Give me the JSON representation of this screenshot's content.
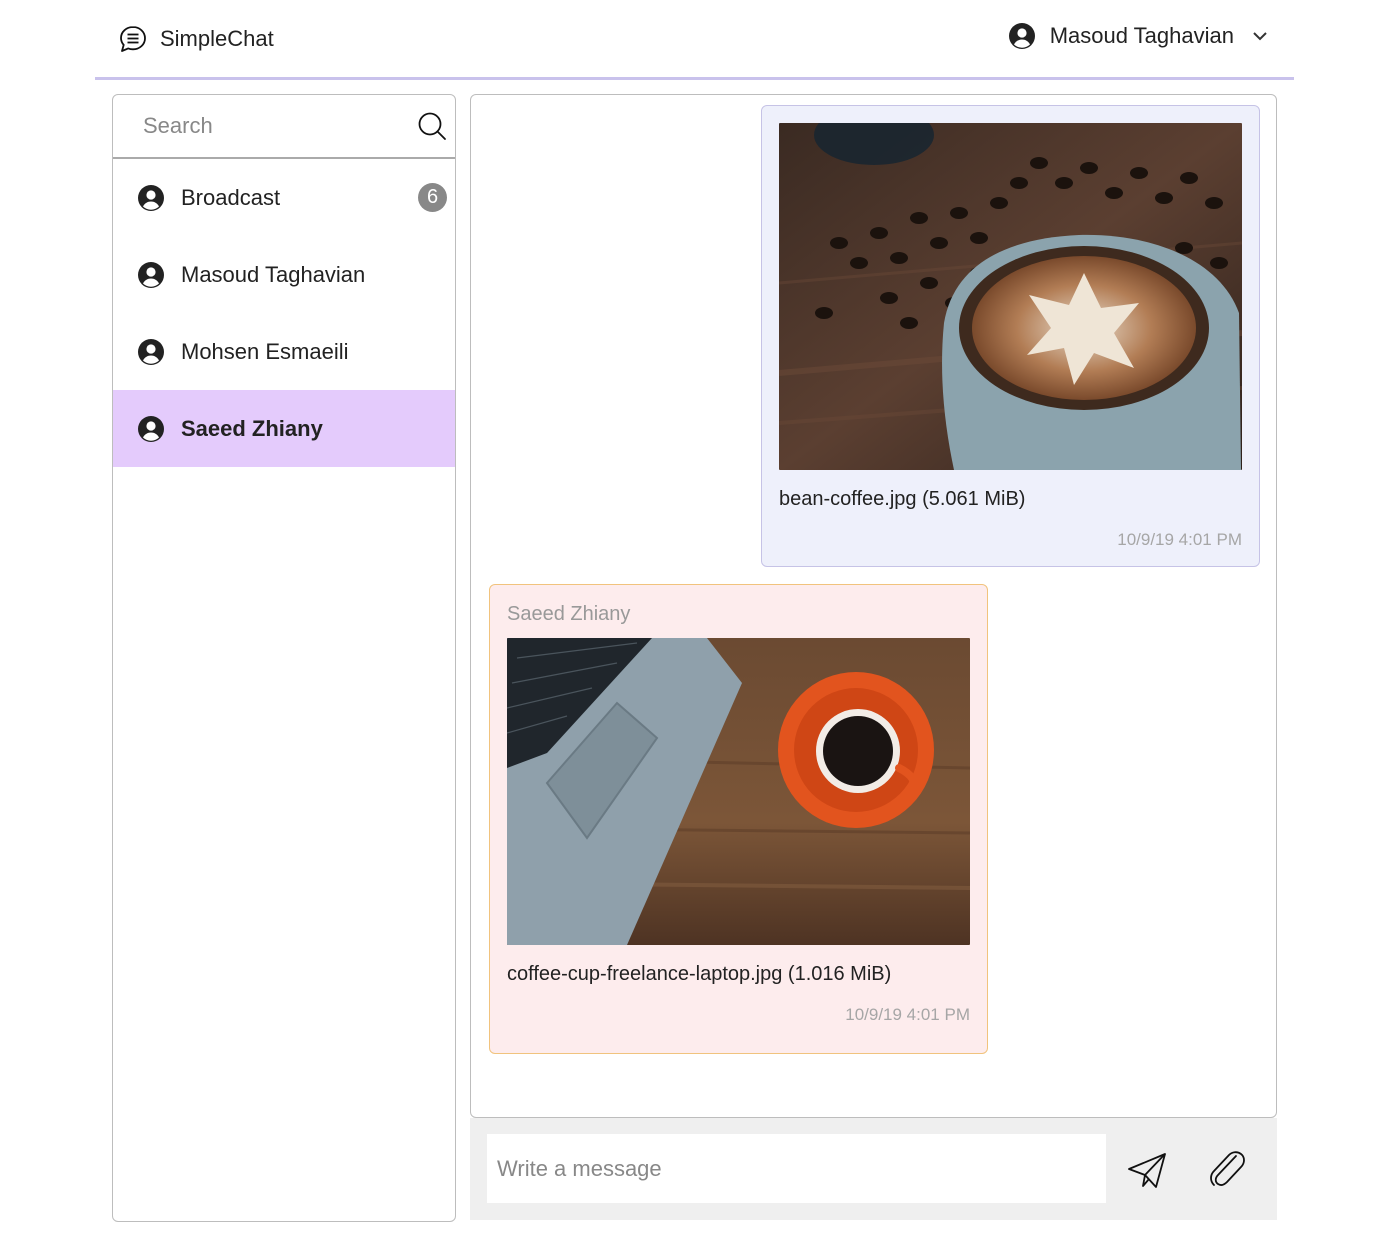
{
  "header": {
    "app_name": "SimpleChat",
    "app_icon": "chat-bubble-icon",
    "current_user": "Masoud Taghavian",
    "user_icon": "user-circle-icon",
    "menu_icon": "chevron-down-icon"
  },
  "sidebar": {
    "search": {
      "placeholder": "Search",
      "value": ""
    },
    "contacts": [
      {
        "name": "Broadcast",
        "badge": "6",
        "active": false
      },
      {
        "name": "Masoud Taghavian",
        "badge": "",
        "active": false
      },
      {
        "name": "Mohsen Esmaeili",
        "badge": "",
        "active": false
      },
      {
        "name": "Saeed Zhiany",
        "badge": "",
        "active": true
      }
    ]
  },
  "messages": [
    {
      "direction": "outgoing",
      "sender": "",
      "image_desc": "latte with star foam art and coffee beans",
      "file": "bean-coffee.jpg (5.061 MiB)",
      "time": "10/9/19 4:01 PM"
    },
    {
      "direction": "incoming",
      "sender": "Saeed Zhiany",
      "image_desc": "laptop with orange coffee cup on wooden desk",
      "file": "coffee-cup-freelance-laptop.jpg (1.016 MiB)",
      "time": "10/9/19 4:01 PM"
    }
  ],
  "composer": {
    "placeholder": "Write a message",
    "value": "",
    "send_icon": "paper-plane-icon",
    "attach_icon": "paperclip-icon"
  },
  "colors": {
    "header_border": "#c9c2ec",
    "active_contact": "#e4cbfc",
    "outgoing_bubble": "#eef0fb",
    "incoming_bubble": "#fdeced",
    "incoming_border": "#f1c37d",
    "badge": "#888888"
  }
}
